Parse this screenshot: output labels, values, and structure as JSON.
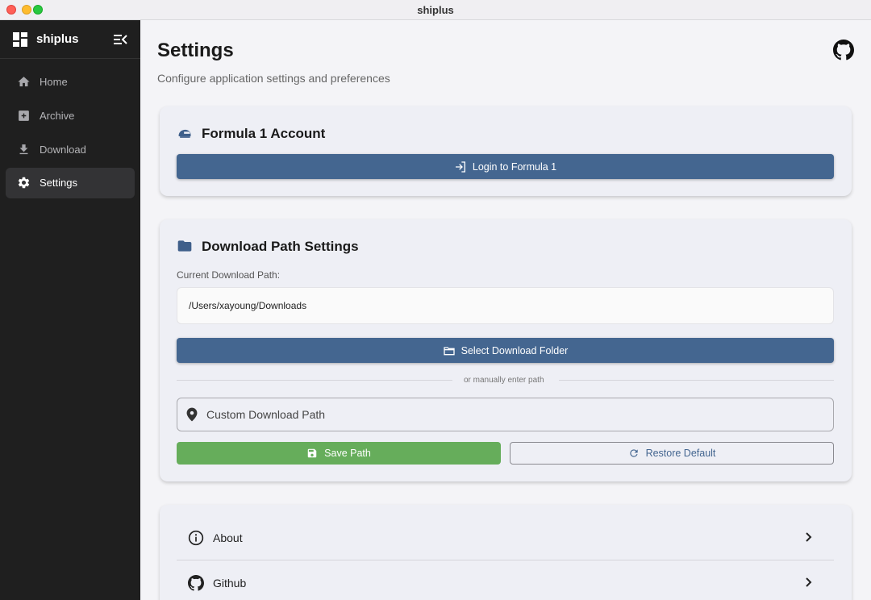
{
  "window": {
    "title": "shiplus"
  },
  "sidebar": {
    "brand": "shiplus",
    "items": [
      {
        "label": "Home",
        "icon": "home-icon"
      },
      {
        "label": "Archive",
        "icon": "archive-icon"
      },
      {
        "label": "Download",
        "icon": "download-icon"
      },
      {
        "label": "Settings",
        "icon": "gear-icon",
        "active": true
      }
    ]
  },
  "header": {
    "title": "Settings",
    "subtitle": "Configure application settings and preferences"
  },
  "f1_card": {
    "title": "Formula 1 Account",
    "login_label": "Login to Formula 1"
  },
  "download_card": {
    "title": "Download Path Settings",
    "current_label": "Current Download Path:",
    "current_path": "/Users/xayoung/Downloads",
    "select_label": "Select Download Folder",
    "divider_text": "or manually enter path",
    "custom_placeholder": "Custom Download Path",
    "save_label": "Save Path",
    "restore_label": "Restore Default"
  },
  "links_card": {
    "items": [
      {
        "label": "About",
        "icon": "info-icon"
      },
      {
        "label": "Github",
        "icon": "github-icon"
      }
    ]
  },
  "colors": {
    "sidebar_bg": "#1f1f1f",
    "primary": "#446690",
    "success": "#66ad5b",
    "page_bg": "#f4f4f7"
  }
}
